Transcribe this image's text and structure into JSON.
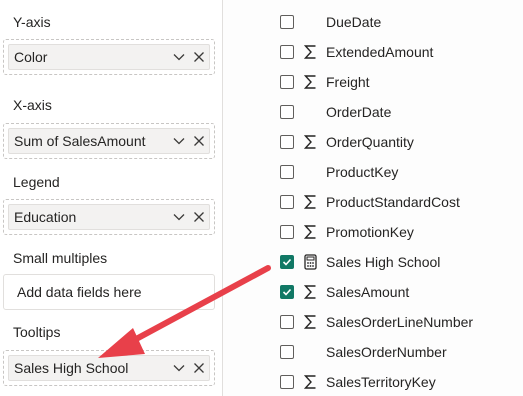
{
  "wells": {
    "yaxis": {
      "title": "Y-axis",
      "field": "Color"
    },
    "xaxis": {
      "title": "X-axis",
      "field": "Sum of SalesAmount"
    },
    "legend": {
      "title": "Legend",
      "field": "Education"
    },
    "small_multiples": {
      "title": "Small multiples",
      "placeholder": "Add data fields here"
    },
    "tooltips": {
      "title": "Tooltips",
      "field": "Sales High School"
    }
  },
  "fields": [
    {
      "name": "DueDate",
      "checked": false,
      "icon": "none"
    },
    {
      "name": "ExtendedAmount",
      "checked": false,
      "icon": "sigma-icon"
    },
    {
      "name": "Freight",
      "checked": false,
      "icon": "sigma-icon"
    },
    {
      "name": "OrderDate",
      "checked": false,
      "icon": "none"
    },
    {
      "name": "OrderQuantity",
      "checked": false,
      "icon": "sigma-icon"
    },
    {
      "name": "ProductKey",
      "checked": false,
      "icon": "none"
    },
    {
      "name": "ProductStandardCost",
      "checked": false,
      "icon": "sigma-icon"
    },
    {
      "name": "PromotionKey",
      "checked": false,
      "icon": "sigma-icon"
    },
    {
      "name": "Sales High School",
      "checked": true,
      "icon": "calculator-icon"
    },
    {
      "name": "SalesAmount",
      "checked": true,
      "icon": "sigma-icon"
    },
    {
      "name": "SalesOrderLineNumber",
      "checked": false,
      "icon": "sigma-icon"
    },
    {
      "name": "SalesOrderNumber",
      "checked": false,
      "icon": "none"
    },
    {
      "name": "SalesTerritoryKey",
      "checked": false,
      "icon": "sigma-icon"
    }
  ],
  "colors": {
    "check_accent": "#117865",
    "arrow": "#e8404a"
  }
}
